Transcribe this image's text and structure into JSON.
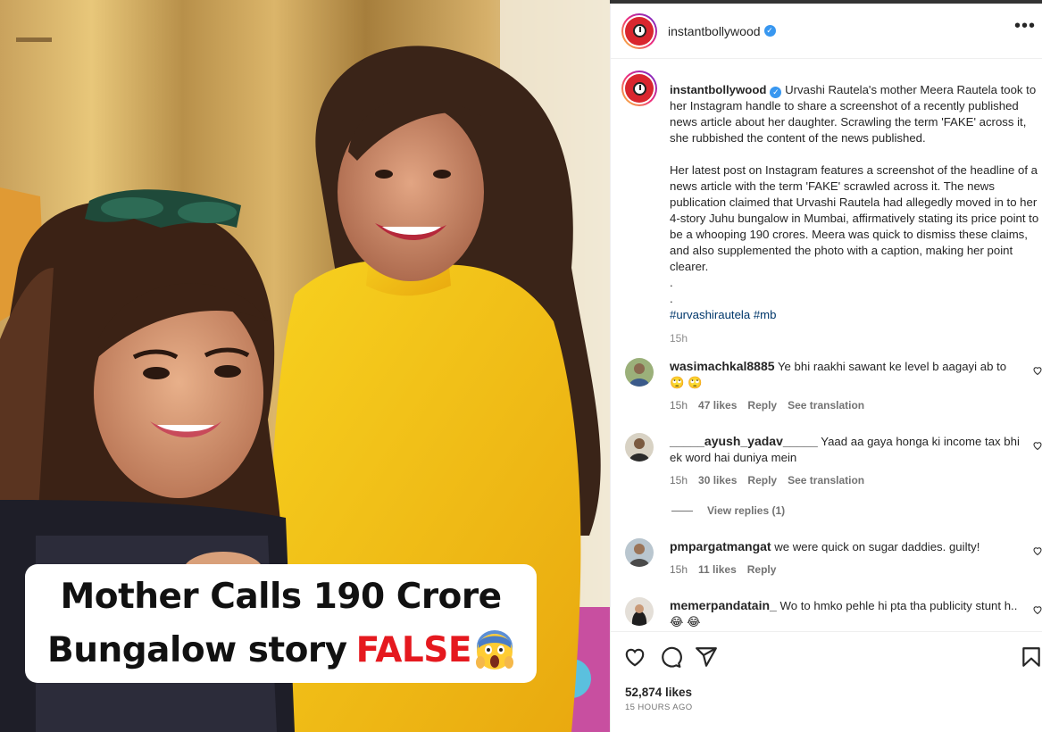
{
  "post": {
    "image_caption_line1": "Mother Calls 190 Crore",
    "image_caption_line2": "Bungalow story",
    "image_caption_highlight": "FALSE",
    "image_caption_emoji": "😱"
  },
  "header": {
    "username": "instantbollywood",
    "verified_icon": "verified-badge-icon",
    "more_icon": "more-options-icon"
  },
  "caption": {
    "username": "instantbollywood",
    "para1": "Urvashi Rautela's mother Meera Rautela took to her Instagram handle to share a screenshot of a recently published news article about her daughter. Scrawling the term 'FAKE' across it, she rubbished the content of the news published.",
    "para2": "Her latest post on Instagram features a screenshot of the headline of a news article with the term 'FAKE' scrawled across it. The news publication claimed that Urvashi Rautela had allegedly moved in to her 4-story Juhu bungalow in Mumbai, affirmatively stating its price point to be a whooping 190 crores. Meera was quick to dismiss these claims, and also supplemented the photo with a caption, making her point clearer.",
    "dot1": ".",
    "dot2": ".",
    "hashtag1": "#urvashirautela",
    "hashtag2": "#mb",
    "time": "15h"
  },
  "comments": [
    {
      "username": "wasimachkal8885",
      "text": "Ye bhi raakhi sawant ke level b aagayi ab to",
      "emoji": "🙄 🙄",
      "time": "15h",
      "likes": "47 likes",
      "reply": "Reply",
      "translate": "See translation"
    },
    {
      "username": "_____ayush_yadav_____",
      "text": "Yaad aa gaya honga ki income tax bhi ek word hai duniya mein",
      "time": "15h",
      "likes": "30 likes",
      "reply": "Reply",
      "translate": "See translation",
      "view_replies": "View replies (1)"
    },
    {
      "username": "pmpargatmangat",
      "text": "we were quick on sugar daddies. guilty!",
      "time": "15h",
      "likes": "11 likes",
      "reply": "Reply"
    },
    {
      "username": "memerpandatain_",
      "text": "Wo to hmko pehle hi pta tha publicity stunt h..",
      "emoji": "😂 😂"
    }
  ],
  "actions": {
    "like_icon": "heart-icon",
    "comment_icon": "comment-icon",
    "share_icon": "share-icon",
    "save_icon": "bookmark-icon",
    "likes": "52,874 likes",
    "time_ago": "15 HOURS AGO"
  },
  "colors": {
    "caption_red": "#e5191f",
    "hashtag": "#00376b",
    "verified": "#3897f0"
  }
}
